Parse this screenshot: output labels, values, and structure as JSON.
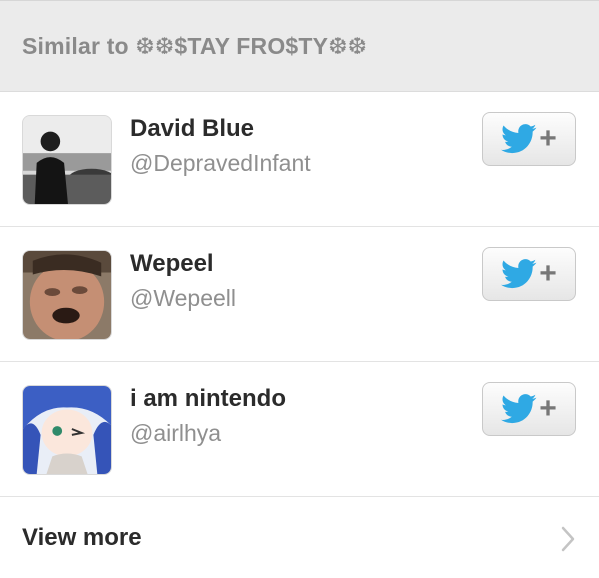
{
  "header": {
    "title": "Similar to ❆❆$TAY FRO$TY❆❆"
  },
  "users": [
    {
      "name": "David Blue",
      "handle": "@DepravedInfant",
      "avatar": "photo-man-by-car"
    },
    {
      "name": "Wepeel",
      "handle": "@Wepeell",
      "avatar": "photo-face-closeup"
    },
    {
      "name": "i am nintendo",
      "handle": "@airlhya",
      "avatar": "anime-girl-blue-hair"
    }
  ],
  "follow_button": {
    "icon": "twitter-bird-icon",
    "symbol": "+"
  },
  "footer": {
    "view_more_label": "View more",
    "icon": "chevron-right-icon"
  },
  "colors": {
    "twitter_blue": "#2fa9e4",
    "header_bg": "#ebebeb",
    "header_text": "#8a8a8a"
  }
}
